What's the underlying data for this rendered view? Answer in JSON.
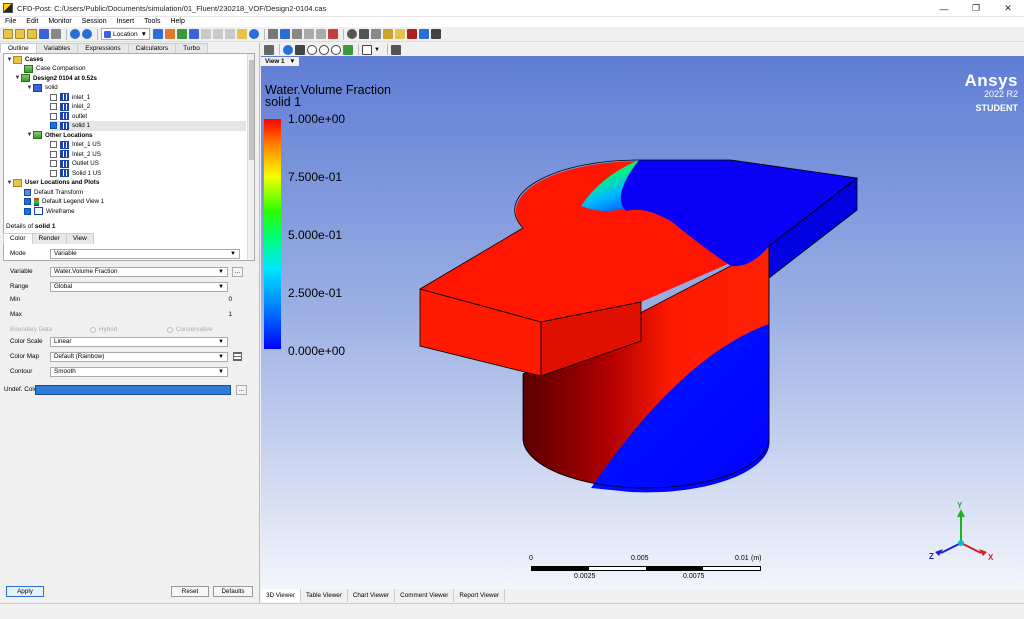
{
  "window": {
    "title": "CFD-Post: C:/Users/Public/Documents/simulation/01_Fluent/230218_VOF/Design2-0104.cas"
  },
  "menu": [
    "File",
    "Edit",
    "Monitor",
    "Session",
    "Insert",
    "Tools",
    "Help"
  ],
  "toolbar": {
    "location_label": "Location"
  },
  "outline_tabs": [
    "Outline",
    "Variables",
    "Expressions",
    "Calculators",
    "Turbo"
  ],
  "tree": {
    "cases": "Cases",
    "case_comparison": "Case Comparison",
    "design": "Design2 0104 at 0.52s",
    "solid_domain": "solid",
    "inlet1": "inlet_1",
    "inlet2": "inlet_2",
    "outlet": "outlet",
    "solid1": "solid 1",
    "other_locations": "Other Locations",
    "inlet1_us": "Inlet_1 US",
    "inlet2_us": "Inlet_2 US",
    "outlet_us": "Outlet US",
    "solid1_us": "Solid 1 US",
    "user_locations": "User Locations and Plots",
    "default_transform": "Default Transform",
    "default_legend": "Default Legend View 1",
    "wireframe": "Wireframe"
  },
  "details": {
    "title_prefix": "Details of ",
    "title_object": "solid 1",
    "tabs": [
      "Color",
      "Render",
      "View"
    ],
    "mode_label": "Mode",
    "mode_value": "Variable",
    "variable_label": "Variable",
    "variable_value": "Water.Volume Fraction",
    "range_label": "Range",
    "range_value": "Global",
    "min_label": "Min",
    "min_value": "0",
    "max_label": "Max",
    "max_value": "1",
    "boundary_label": "Boundary Data",
    "hybrid": "Hybrid",
    "conservative": "Conservative",
    "color_scale_label": "Color Scale",
    "color_scale_value": "Linear",
    "color_map_label": "Color Map",
    "color_map_value": "Default (Rainbow)",
    "contour_label": "Contour",
    "contour_value": "Smooth",
    "undef_label": "Undef. Color",
    "dots": "...",
    "apply": "Apply",
    "reset": "Reset",
    "defaults": "Defaults"
  },
  "viewer": {
    "view_tab": "View 1",
    "brand": "Ansys",
    "version": "2022 R2",
    "edition": "STUDENT",
    "legend_title": "Water.Volume Fraction",
    "legend_sub": "solid 1",
    "legend_labels": [
      "1.000e+00",
      "7.500e-01",
      "5.000e-01",
      "2.500e-01",
      "0.000e+00"
    ],
    "scale_top": [
      "0",
      "0.005",
      "0.01",
      "(m)"
    ],
    "scale_bottom": [
      "0.0025",
      "0.0075"
    ],
    "axis": {
      "x": "X",
      "y": "Y",
      "z": "Z"
    }
  },
  "bottom_tabs": [
    "3D Viewer",
    "Table Viewer",
    "Chart Viewer",
    "Comment Viewer",
    "Report Viewer"
  ],
  "colors": {
    "water": "#ff0000",
    "air": "#0000ff",
    "accent": "#2a6ed8"
  }
}
